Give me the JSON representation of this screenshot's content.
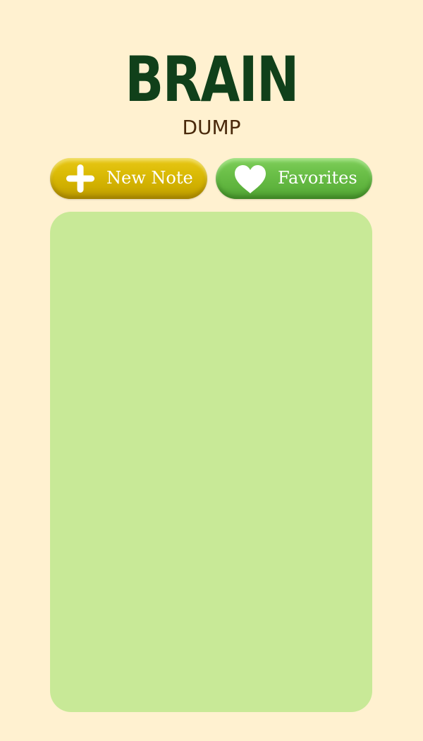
{
  "header": {
    "title": "BRAIN",
    "subtitle": "DUMP"
  },
  "toolbar": {
    "new_note": {
      "label": "New Note",
      "icon": "plus-icon"
    },
    "favorites": {
      "label": "Favorites",
      "icon": "heart-icon"
    }
  },
  "colors": {
    "background": "#fff1d0",
    "title": "#10401a",
    "subtitle": "#4a2a0c",
    "new_note_button": "#dcbc07",
    "favorites_button": "#6cc049",
    "notes_panel": "#c8e997",
    "button_text": "#ffffff"
  }
}
